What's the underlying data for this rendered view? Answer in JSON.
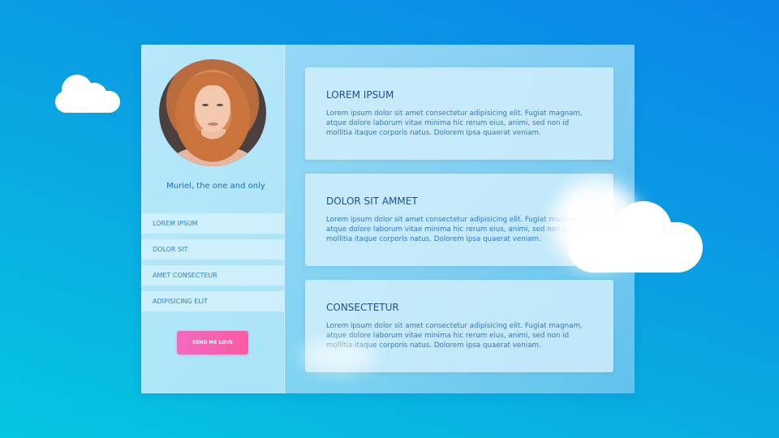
{
  "profile": {
    "name": "Muriel, the one and only"
  },
  "nav": {
    "items": [
      "LOREM IPSUM",
      "DOLOR SIT",
      "AMET CONSECTEUR",
      "ADIPISICING ELIT"
    ]
  },
  "actions": {
    "love_button": "SEND ME LOVE"
  },
  "panels": [
    {
      "title": "LOREM IPSUM",
      "body": "Lorem ipsum dolor sit amet consectetur adipisicing elit. Fugiat magnam, atque dolore laborum vitae minima hic rerum eius, animi, sed non id mollitia itaque corporis natus. Dolorem ipsa quaerat veniam."
    },
    {
      "title": "DOLOR SIT AMMET",
      "body": "Lorem ipsum dolor sit amet consectetur adipisicing elit. Fugiat magnam, atque dolore laborum vitae minima hic rerum eius, animi, sed non id mollitia itaque corporis natus. Dolorem ipsa quaerat veniam."
    },
    {
      "title": "CONSECTETUR",
      "body": "Lorem ipsum dolor sit amet consectetur adipisicing elit. Fugiat magnam, atque dolore laborum vitae minima hic rerum eius, animi, sed non id mollitia itaque corporis natus. Dolorem ipsa quaerat veniam."
    }
  ],
  "colors": {
    "accent_pink": "#f06abf",
    "heading_blue": "#1f4f94",
    "text_blue": "#2f78c8"
  },
  "icons": {
    "decor_left": "cloud-icon",
    "decor_right": "cloud-icon"
  }
}
